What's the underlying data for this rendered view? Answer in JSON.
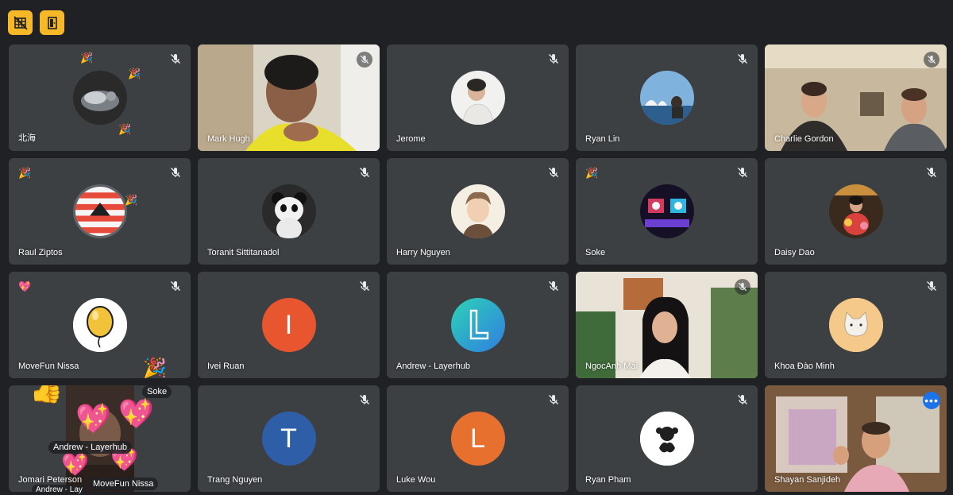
{
  "toolbar": {
    "btn1_icon": "grid-off-icon",
    "btn2_icon": "exit-door-icon",
    "accent": "#f6b826"
  },
  "participants": [
    {
      "name": "北海",
      "avatar": "seal-avatar",
      "muted": true
    },
    {
      "name": "Mark Hugh",
      "avatar": "video",
      "muted": true
    },
    {
      "name": "Jerome",
      "avatar": "photo-avatar",
      "muted": true
    },
    {
      "name": "Ryan Lin",
      "avatar": "photo-avatar",
      "muted": true
    },
    {
      "name": "Charlie Gordon",
      "avatar": "video",
      "muted": true
    },
    {
      "name": "Raul Ziptos",
      "avatar": "logo-avatar",
      "muted": true
    },
    {
      "name": "Toranit Sittitanadol",
      "avatar": "panda-avatar",
      "muted": true
    },
    {
      "name": "Harry Nguyen",
      "avatar": "cartoon-avatar",
      "muted": true
    },
    {
      "name": "Soke",
      "avatar": "neon-avatar",
      "muted": true
    },
    {
      "name": "Daisy Dao",
      "avatar": "photo-avatar",
      "muted": true
    },
    {
      "name": "MoveFun Nissa",
      "avatar": "balloon-avatar",
      "muted": true
    },
    {
      "name": "Ivei Ruan",
      "avatar": "letter",
      "letter": "I",
      "color": "#e8562f",
      "muted": true
    },
    {
      "name": "Andrew - Layerhub",
      "avatar": "logo-L-avatar",
      "muted": true
    },
    {
      "name": "NgocAnh Mai",
      "avatar": "video",
      "muted": true
    },
    {
      "name": "Khoa Đào Minh",
      "avatar": "cat-avatar",
      "muted": true
    },
    {
      "name": "Jomari Peterson",
      "avatar": "video",
      "muted": false
    },
    {
      "name": "Trang Nguyen",
      "avatar": "letter",
      "letter": "T",
      "color": "#2f5ea8",
      "muted": true
    },
    {
      "name": "Luke Wou",
      "avatar": "letter",
      "letter": "L",
      "color": "#e8702f",
      "muted": true
    },
    {
      "name": "Ryan Pham",
      "avatar": "monkey-avatar",
      "muted": true
    },
    {
      "name": "Shayan Sanjideh",
      "avatar": "video",
      "muted": false,
      "self": true
    }
  ],
  "reaction_labels": {
    "soke": "Soke",
    "andrew": "Andrew - Layerhub",
    "movefun": "MoveFun Nissa",
    "andrew_cut": "Andrew - Lay"
  },
  "self_menu": "more-options-icon"
}
